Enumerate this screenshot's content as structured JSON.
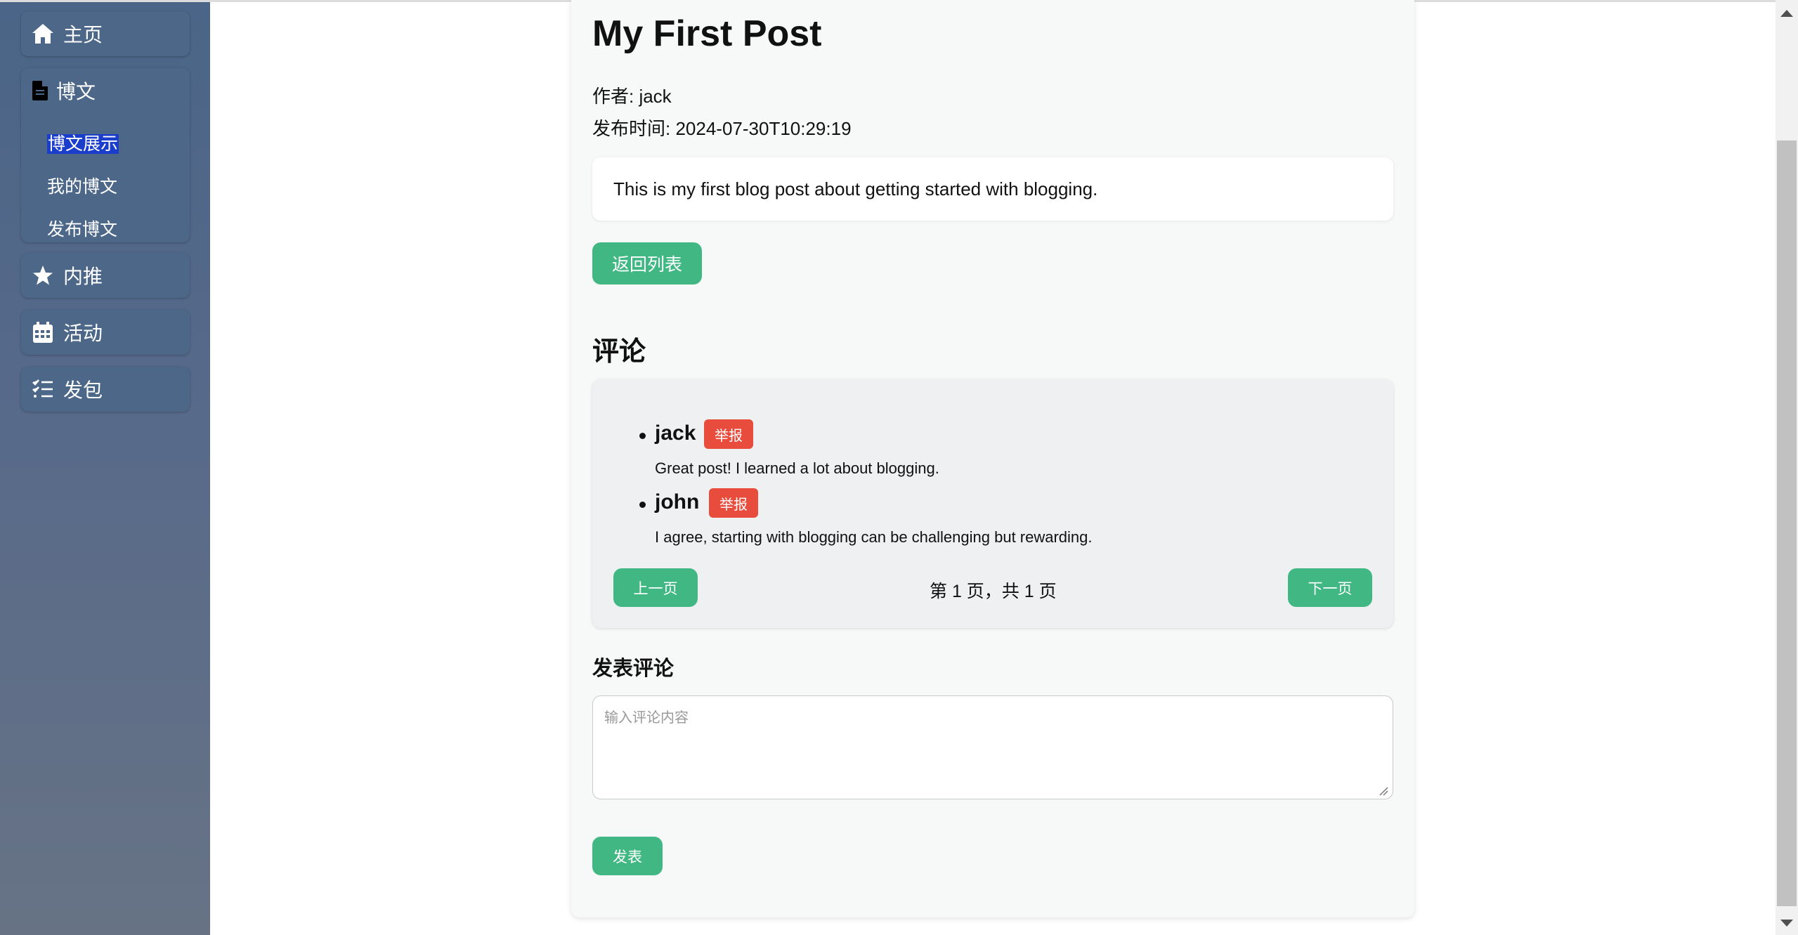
{
  "sidebar": {
    "home": {
      "label": "主页",
      "icon": "home-icon"
    },
    "blog": {
      "label": "博文",
      "icon": "document-icon",
      "items": [
        {
          "label": "博文展示",
          "selected": true
        },
        {
          "label": "我的博文",
          "selected": false
        },
        {
          "label": "发布博文",
          "selected": false
        }
      ]
    },
    "referral": {
      "label": "内推",
      "icon": "star-icon"
    },
    "events": {
      "label": "活动",
      "icon": "calendar-icon"
    },
    "gigs": {
      "label": "发包",
      "icon": "checklist-icon"
    }
  },
  "post": {
    "title": "My First Post",
    "author": "作者: jack",
    "published": "发布时间: 2024-07-30T10:29:19",
    "content": "This is my first blog post about getting started with blogging.",
    "back_label": "返回列表"
  },
  "comments": {
    "heading": "评论",
    "report_label": "举报",
    "items": [
      {
        "author": "jack",
        "text": "Great post! I learned a lot about blogging."
      },
      {
        "author": "john",
        "text": "I agree, starting with blogging can be challenging but rewarding."
      }
    ],
    "prev_label": "上一页",
    "next_label": "下一页",
    "page_info": "第 1 页，共 1 页"
  },
  "new_comment": {
    "heading": "发表评论",
    "placeholder": "输入评论内容",
    "submit_label": "发表"
  },
  "colors": {
    "accent": "#41b883",
    "report": "#e74c3c",
    "sidebar": "#4d6789"
  }
}
